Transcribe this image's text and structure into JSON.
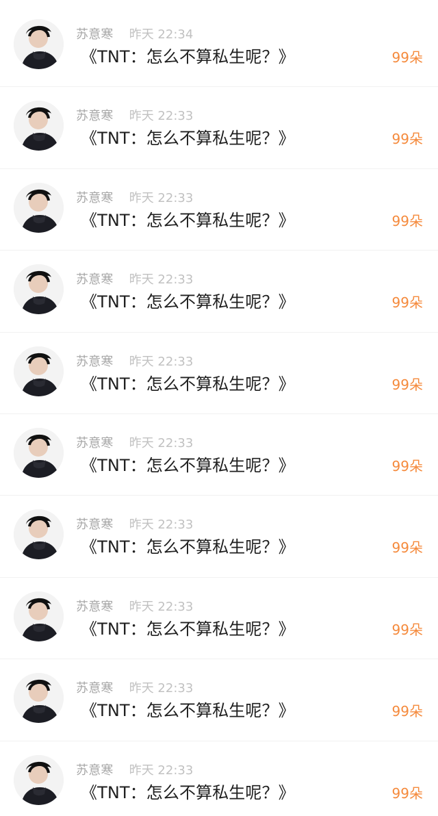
{
  "feed": {
    "items": [
      {
        "avatar_icon": "avatar-icon",
        "username": "苏意寒",
        "time": "昨天 22:34",
        "message": "《TNT：怎么不算私生呢？》",
        "gift": "99朵"
      },
      {
        "avatar_icon": "avatar-icon",
        "username": "苏意寒",
        "time": "昨天 22:33",
        "message": "《TNT：怎么不算私生呢？》",
        "gift": "99朵"
      },
      {
        "avatar_icon": "avatar-icon",
        "username": "苏意寒",
        "time": "昨天 22:33",
        "message": "《TNT：怎么不算私生呢？》",
        "gift": "99朵"
      },
      {
        "avatar_icon": "avatar-icon",
        "username": "苏意寒",
        "time": "昨天 22:33",
        "message": "《TNT：怎么不算私生呢？》",
        "gift": "99朵"
      },
      {
        "avatar_icon": "avatar-icon",
        "username": "苏意寒",
        "time": "昨天 22:33",
        "message": "《TNT：怎么不算私生呢？》",
        "gift": "99朵"
      },
      {
        "avatar_icon": "avatar-icon",
        "username": "苏意寒",
        "time": "昨天 22:33",
        "message": "《TNT：怎么不算私生呢？》",
        "gift": "99朵"
      },
      {
        "avatar_icon": "avatar-icon",
        "username": "苏意寒",
        "time": "昨天 22:33",
        "message": "《TNT：怎么不算私生呢？》",
        "gift": "99朵"
      },
      {
        "avatar_icon": "avatar-icon",
        "username": "苏意寒",
        "time": "昨天 22:33",
        "message": "《TNT：怎么不算私生呢？》",
        "gift": "99朵"
      },
      {
        "avatar_icon": "avatar-icon",
        "username": "苏意寒",
        "time": "昨天 22:33",
        "message": "《TNT：怎么不算私生呢？》",
        "gift": "99朵"
      },
      {
        "avatar_icon": "avatar-icon",
        "username": "苏意寒",
        "time": "昨天 22:33",
        "message": "《TNT：怎么不算私生呢？》",
        "gift": "99朵"
      }
    ]
  },
  "colors": {
    "background": "#ffffff",
    "username": "#a7a7a7",
    "time": "#c1c1c1",
    "message": "#1f1f1f",
    "gift": "#f58a3c",
    "divider": "#f1f1f1"
  }
}
